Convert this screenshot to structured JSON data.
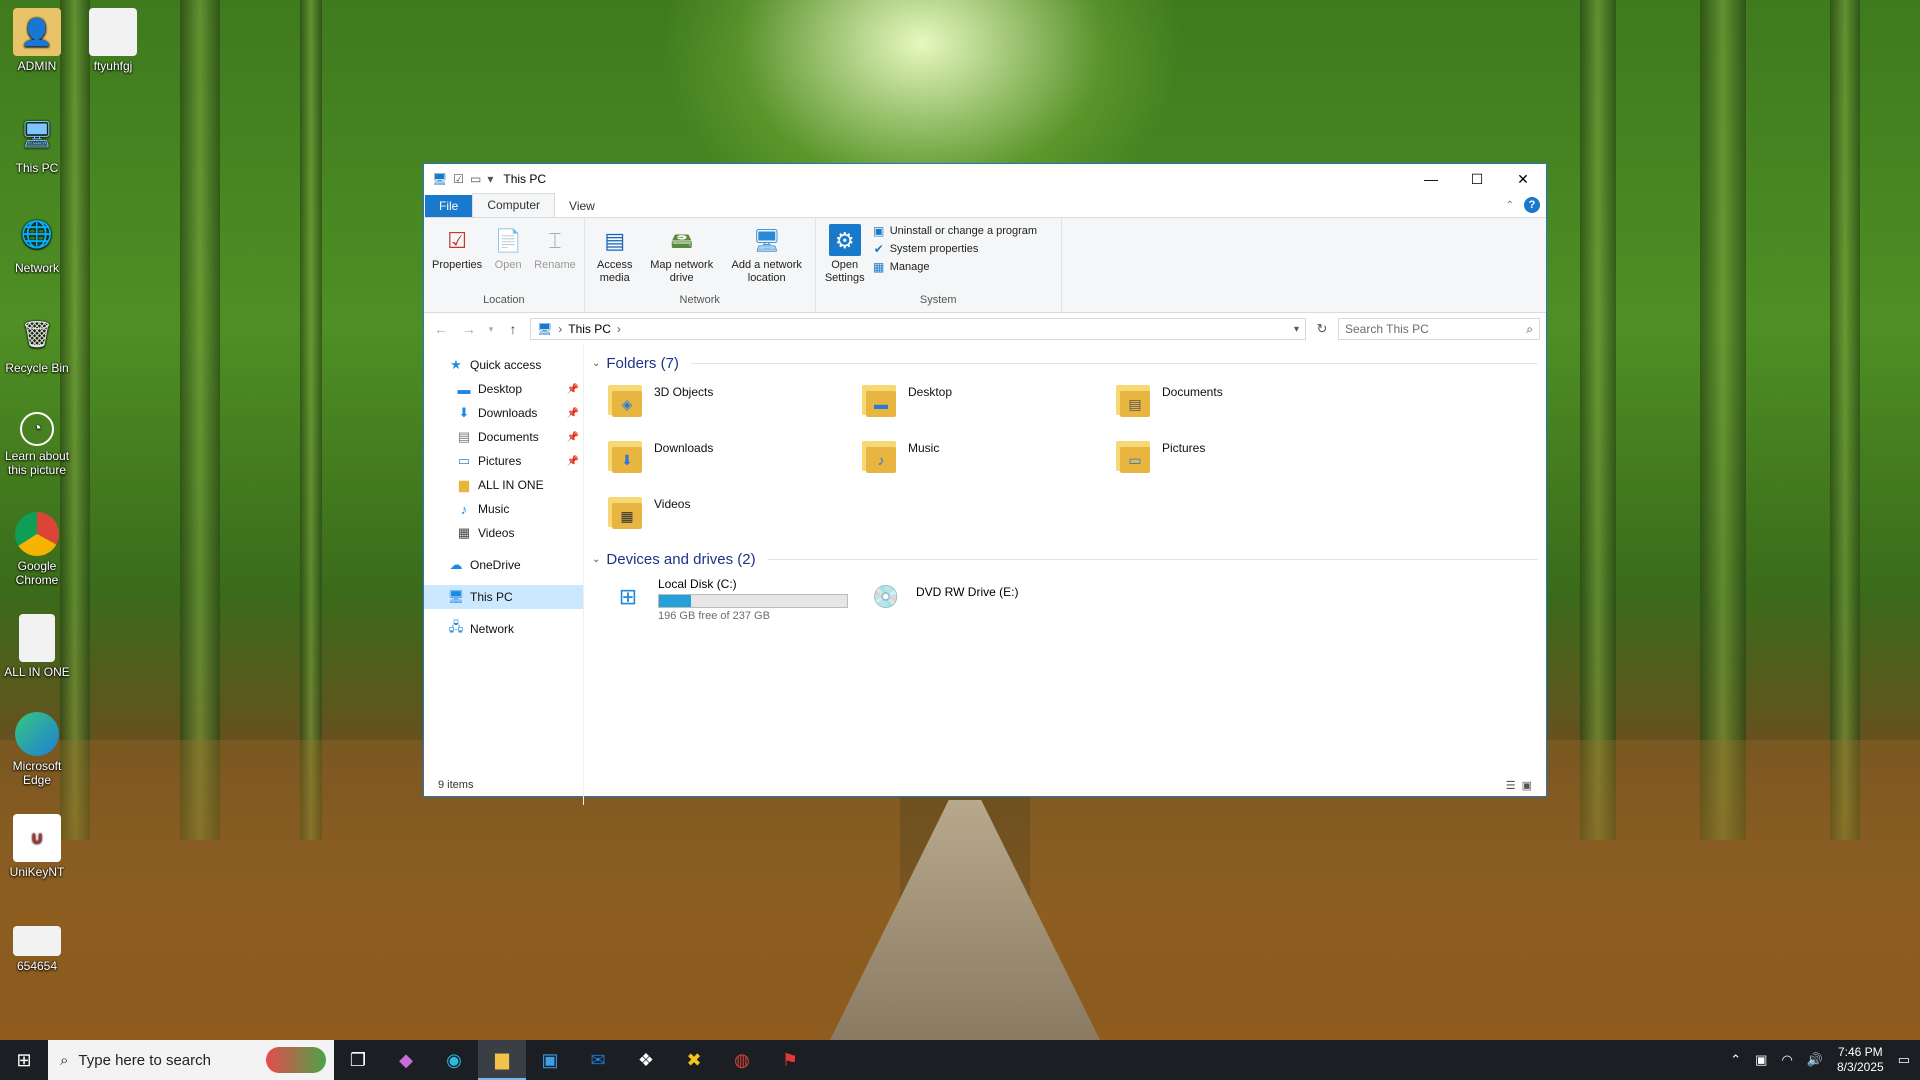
{
  "desktop": {
    "icons": [
      {
        "label": "ADMIN",
        "icon": "user-folder-icon"
      },
      {
        "label": "ftyuhfgj",
        "icon": "document-icon"
      },
      {
        "label": "This PC",
        "icon": "computer-icon"
      },
      {
        "label": "Network",
        "icon": "network-icon"
      },
      {
        "label": "Recycle Bin",
        "icon": "recycle-bin-icon"
      },
      {
        "label": "Learn about this picture",
        "icon": "camera-icon"
      },
      {
        "label": "Google Chrome",
        "icon": "chrome-icon"
      },
      {
        "label": "ALL IN ONE",
        "icon": "document-icon"
      },
      {
        "label": "Microsoft Edge",
        "icon": "edge-icon"
      },
      {
        "label": "UniKeyNT",
        "icon": "unikey-icon"
      },
      {
        "label": "654654",
        "icon": "document-icon"
      }
    ]
  },
  "window": {
    "title": "This PC",
    "tabs": {
      "file": "File",
      "computer": "Computer",
      "view": "View"
    },
    "ribbon": {
      "location": {
        "label": "Location",
        "properties": "Properties",
        "open": "Open",
        "rename": "Rename"
      },
      "network": {
        "label": "Network",
        "access_media": "Access media",
        "map_drive": "Map network drive",
        "add_location": "Add a network location"
      },
      "system": {
        "label": "System",
        "open_settings": "Open Settings",
        "uninstall": "Uninstall or change a program",
        "system_properties": "System properties",
        "manage": "Manage"
      }
    },
    "address": {
      "path": "This PC",
      "search_placeholder": "Search This PC"
    },
    "nav": {
      "quick_access": "Quick access",
      "pinned": [
        "Desktop",
        "Downloads",
        "Documents",
        "Pictures"
      ],
      "others": [
        "ALL IN ONE",
        "Music",
        "Videos"
      ],
      "onedrive": "OneDrive",
      "this_pc": "This PC",
      "network": "Network"
    },
    "folders_header": "Folders (7)",
    "folders": [
      "3D Objects",
      "Desktop",
      "Documents",
      "Downloads",
      "Music",
      "Pictures",
      "Videos"
    ],
    "drives_header": "Devices and drives (2)",
    "drives": [
      {
        "name": "Local Disk (C:)",
        "free": "196 GB free of 237 GB",
        "used_fraction": 0.17
      },
      {
        "name": "DVD RW Drive (E:)"
      }
    ],
    "status": "9 items"
  },
  "taskbar": {
    "search_placeholder": "Type here to search",
    "time": "7:46 PM",
    "date": "8/3/2025"
  }
}
